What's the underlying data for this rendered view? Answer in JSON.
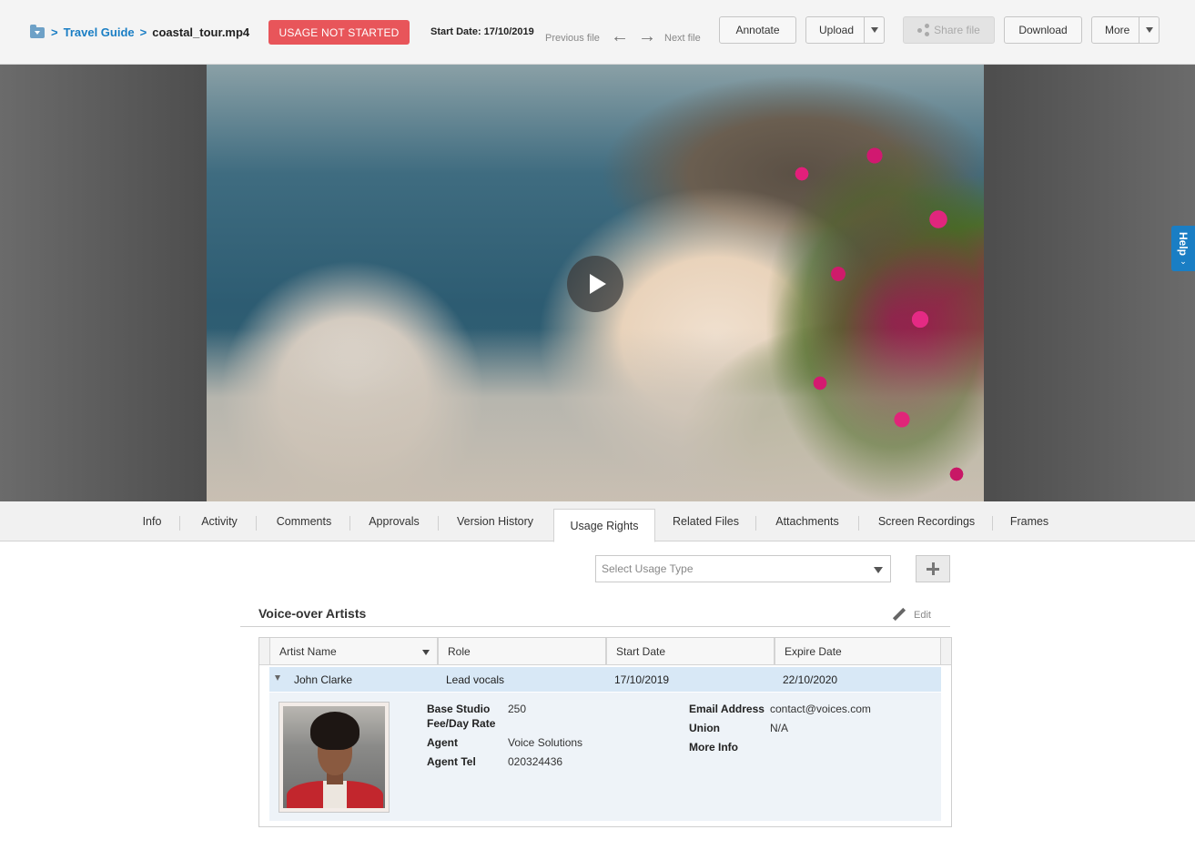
{
  "breadcrumb": {
    "sep": ">",
    "folder": "Travel Guide",
    "file": "coastal_tour.mp4"
  },
  "status": {
    "badge": "USAGE NOT STARTED",
    "badge_color": "#e8555a",
    "start_date": "Start Date: 17/10/2019"
  },
  "nav": {
    "previous": "Previous file",
    "next": "Next file"
  },
  "toolbar": {
    "annotate": "Annotate",
    "upload": "Upload",
    "share": "Share file",
    "download": "Download",
    "more": "More"
  },
  "help": {
    "label": "Help"
  },
  "tabs": [
    {
      "label": "Info"
    },
    {
      "label": "Activity"
    },
    {
      "label": "Comments"
    },
    {
      "label": "Approvals"
    },
    {
      "label": "Version History"
    },
    {
      "label": "Usage Rights",
      "active": true
    },
    {
      "label": "Related Files"
    },
    {
      "label": "Attachments"
    },
    {
      "label": "Screen Recordings"
    },
    {
      "label": "Frames"
    }
  ],
  "usage": {
    "placeholder": "Select Usage Type"
  },
  "section": {
    "title": "Voice-over Artists",
    "edit": "Edit"
  },
  "table": {
    "columns": [
      "Artist Name",
      "Role",
      "Start Date",
      "Expire Date"
    ],
    "rows": [
      {
        "artist": "John Clarke",
        "role": "Lead vocals",
        "start": "17/10/2019",
        "expire": "22/10/2020",
        "details": {
          "fee_label": "Base Studio Fee/Day Rate",
          "fee_value": "250",
          "agent_label": "Agent",
          "agent_value": "Voice Solutions",
          "agent_tel_label": "Agent Tel",
          "agent_tel_value": "020324436",
          "email_label": "Email Address",
          "email_value": "contact@voices.com",
          "union_label": "Union",
          "union_value": "N/A",
          "more_label": "More Info"
        }
      }
    ]
  },
  "colors": {
    "accent": "#1a7ec4",
    "row_highlight": "#d8e8f6",
    "detail_bg": "#eef3f8"
  }
}
